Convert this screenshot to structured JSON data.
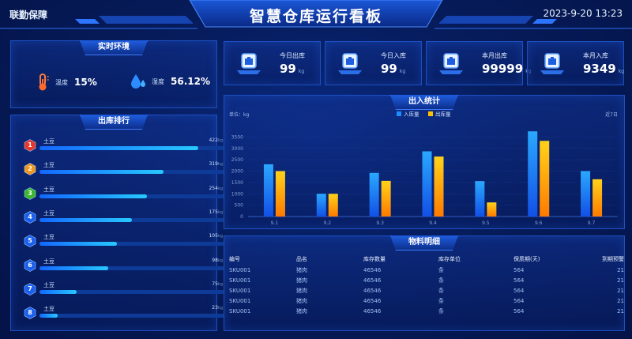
{
  "header": {
    "left_label": "联勤保障",
    "title": "智慧仓库运行看板",
    "datetime": "2023-9-20 13:23"
  },
  "environment": {
    "title": "实时环境",
    "temperature": {
      "label": "温度",
      "value": "15%",
      "icon": "thermometer-icon"
    },
    "humidity": {
      "label": "湿度",
      "value": "56.12%",
      "icon": "droplet-icon"
    }
  },
  "stats": [
    {
      "label": "今日出库",
      "value": "99",
      "unit": "kg"
    },
    {
      "label": "今日入库",
      "value": "99",
      "unit": "kg"
    },
    {
      "label": "本月出库",
      "value": "99999",
      "unit": "kg"
    },
    {
      "label": "本月入库",
      "value": "9349",
      "unit": "kg"
    }
  ],
  "ranking": {
    "title": "出库排行",
    "items": [
      {
        "rank": "1",
        "name": "土豆",
        "value_num": "422",
        "unit": "kg",
        "fraction": 0.86,
        "color": "#e8362a"
      },
      {
        "rank": "2",
        "name": "土豆",
        "value_num": "319",
        "unit": "kg",
        "fraction": 0.67,
        "color": "#f0961c"
      },
      {
        "rank": "3",
        "name": "土豆",
        "value_num": "254",
        "unit": "kg",
        "fraction": 0.58,
        "color": "#3cb82c"
      },
      {
        "rank": "4",
        "name": "土豆",
        "value_num": "175",
        "unit": "kg",
        "fraction": 0.5,
        "color": "#1a5ff0"
      },
      {
        "rank": "5",
        "name": "土豆",
        "value_num": "105",
        "unit": "kg",
        "fraction": 0.42,
        "color": "#1a5ff0"
      },
      {
        "rank": "6",
        "name": "土豆",
        "value_num": "98",
        "unit": "kg",
        "fraction": 0.37,
        "color": "#1a5ff0"
      },
      {
        "rank": "7",
        "name": "土豆",
        "value_num": "75",
        "unit": "kg",
        "fraction": 0.2,
        "color": "#1a5ff0"
      },
      {
        "rank": "8",
        "name": "土豆",
        "value_num": "23",
        "unit": "kg",
        "fraction": 0.1,
        "color": "#1a5ff0"
      }
    ]
  },
  "inout": {
    "title": "出入统计",
    "unit_label": "单位：kg",
    "range_label": "近7日"
  },
  "chart_data": {
    "type": "bar",
    "categories": [
      "9.1",
      "9.2",
      "9.3",
      "9.4",
      "9.5",
      "9.6",
      "9.7"
    ],
    "series": [
      {
        "name": "入库量",
        "values": [
          2300,
          1000,
          1920,
          2870,
          1560,
          3750,
          2000
        ],
        "color": "#1e8cff"
      },
      {
        "name": "出库量",
        "values": [
          2000,
          1000,
          1570,
          2640,
          620,
          3330,
          1640
        ],
        "color": "#ffc000"
      }
    ],
    "ylim": [
      0,
      4000
    ],
    "yticks": [
      0,
      500,
      1000,
      1500,
      2000,
      2500,
      3000,
      3500
    ],
    "legend": "top-center",
    "grid": true
  },
  "materials": {
    "title": "物料明细",
    "columns": [
      "编号",
      "品名",
      "库存数量",
      "库存单位",
      "保质期(天)",
      "到期预警"
    ],
    "rows": [
      [
        "SKU001",
        "猪肉",
        "46546",
        "条",
        "564",
        "21"
      ],
      [
        "SKU001",
        "猪肉",
        "46546",
        "条",
        "564",
        "21"
      ],
      [
        "SKU001",
        "猪肉",
        "46546",
        "条",
        "564",
        "21"
      ],
      [
        "SKU001",
        "猪肉",
        "46546",
        "条",
        "564",
        "21"
      ],
      [
        "SKU001",
        "猪肉",
        "46546",
        "条",
        "564",
        "21"
      ]
    ]
  }
}
